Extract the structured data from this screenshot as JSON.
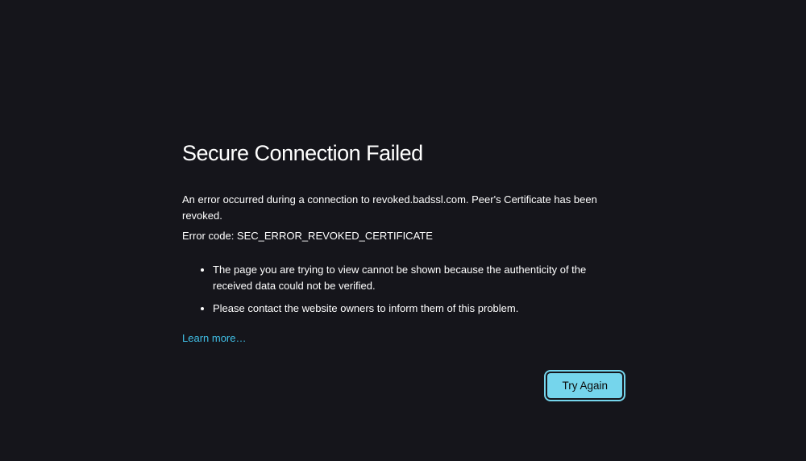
{
  "title": "Secure Connection Failed",
  "paragraph": "An error occurred during a connection to revoked.badssl.com. Peer's Certificate has been revoked.",
  "error_code_prefix": "Error code: ",
  "error_code": "SEC_ERROR_REVOKED_CERTIFICATE",
  "bullets": [
    "The page you are trying to view cannot be shown because the authenticity of the received data could not be verified.",
    "Please contact the website owners to inform them of this problem."
  ],
  "learn_more": "Learn more…",
  "try_again": "Try Again",
  "colors": {
    "background": "#15151b",
    "text": "#ffffff",
    "link": "#40bfe6",
    "button_bg": "#75d5ec",
    "button_text": "#0b0b0b"
  }
}
